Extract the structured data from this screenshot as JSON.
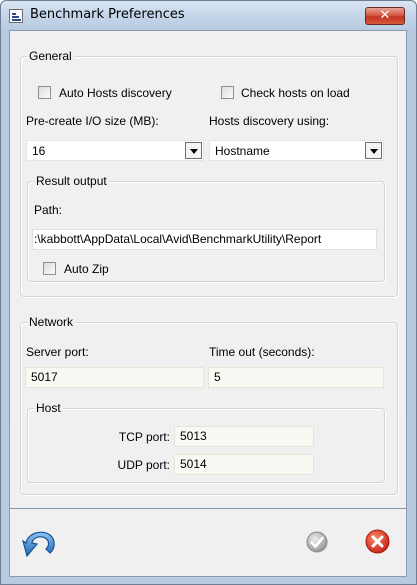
{
  "window": {
    "title": "Benchmark Preferences",
    "close_glyph": "✕"
  },
  "general": {
    "title": "General",
    "auto_hosts_label": "Auto Hosts discovery",
    "auto_hosts_checked": false,
    "check_hosts_label": "Check hosts on load",
    "check_hosts_checked": false,
    "precreate_label": "Pre-create I/O size (MB):",
    "precreate_value": "16",
    "discovery_label": "Hosts discovery using:",
    "discovery_value": "Hostname",
    "result_output": {
      "title": "Result output",
      "path_label": "Path:",
      "path_value": ":\\kabbott\\AppData\\Local\\Avid\\BenchmarkUtility\\Report",
      "autozip_label": "Auto Zip",
      "autozip_checked": false
    }
  },
  "network": {
    "title": "Network",
    "server_port_label": "Server port:",
    "server_port_value": "5017",
    "timeout_label": "Time out (seconds):",
    "timeout_value": "5",
    "host": {
      "title": "Host",
      "tcp_label": "TCP port:",
      "tcp_value": "5013",
      "udp_label": "UDP port:",
      "udp_value": "5014"
    }
  },
  "icons": {
    "undo": "undo-icon",
    "ok": "checkmark-icon",
    "cancel": "close-icon"
  },
  "colors": {
    "title_bar": "#c5d6ea",
    "close_button": "#c2341f",
    "undo_blue": "#2f7fd0",
    "ok_gray": "#9a9a9a",
    "cancel_red": "#d42b1e"
  }
}
